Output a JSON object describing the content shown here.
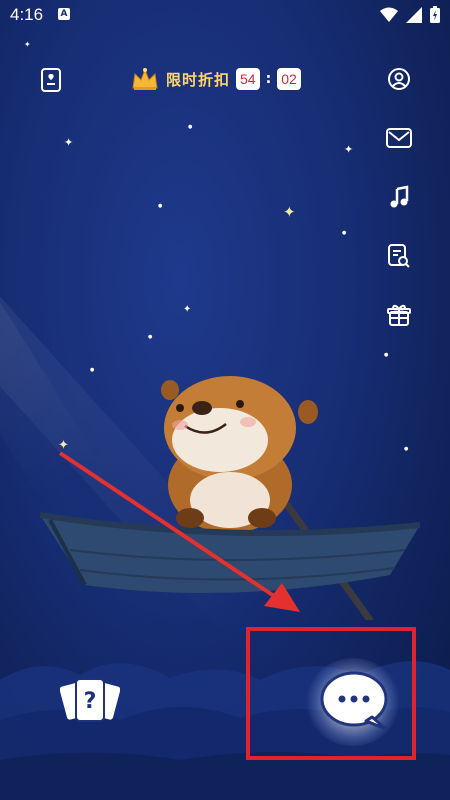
{
  "status_bar": {
    "time": "4:16",
    "notification_badge": "A"
  },
  "promo": {
    "label": "限时折扣",
    "minutes": "54",
    "separator": ":",
    "seconds": "02"
  },
  "right_nav": [
    "profile-icon",
    "mail-icon",
    "music-icon",
    "search-document-icon",
    "gift-icon"
  ],
  "bottom": {
    "cards_symbol": "?"
  },
  "colors": {
    "background": "#172d74",
    "promo_gold": "#ffd66b",
    "timer_red": "#d02a3c",
    "highlight_red": "#e0232d"
  }
}
